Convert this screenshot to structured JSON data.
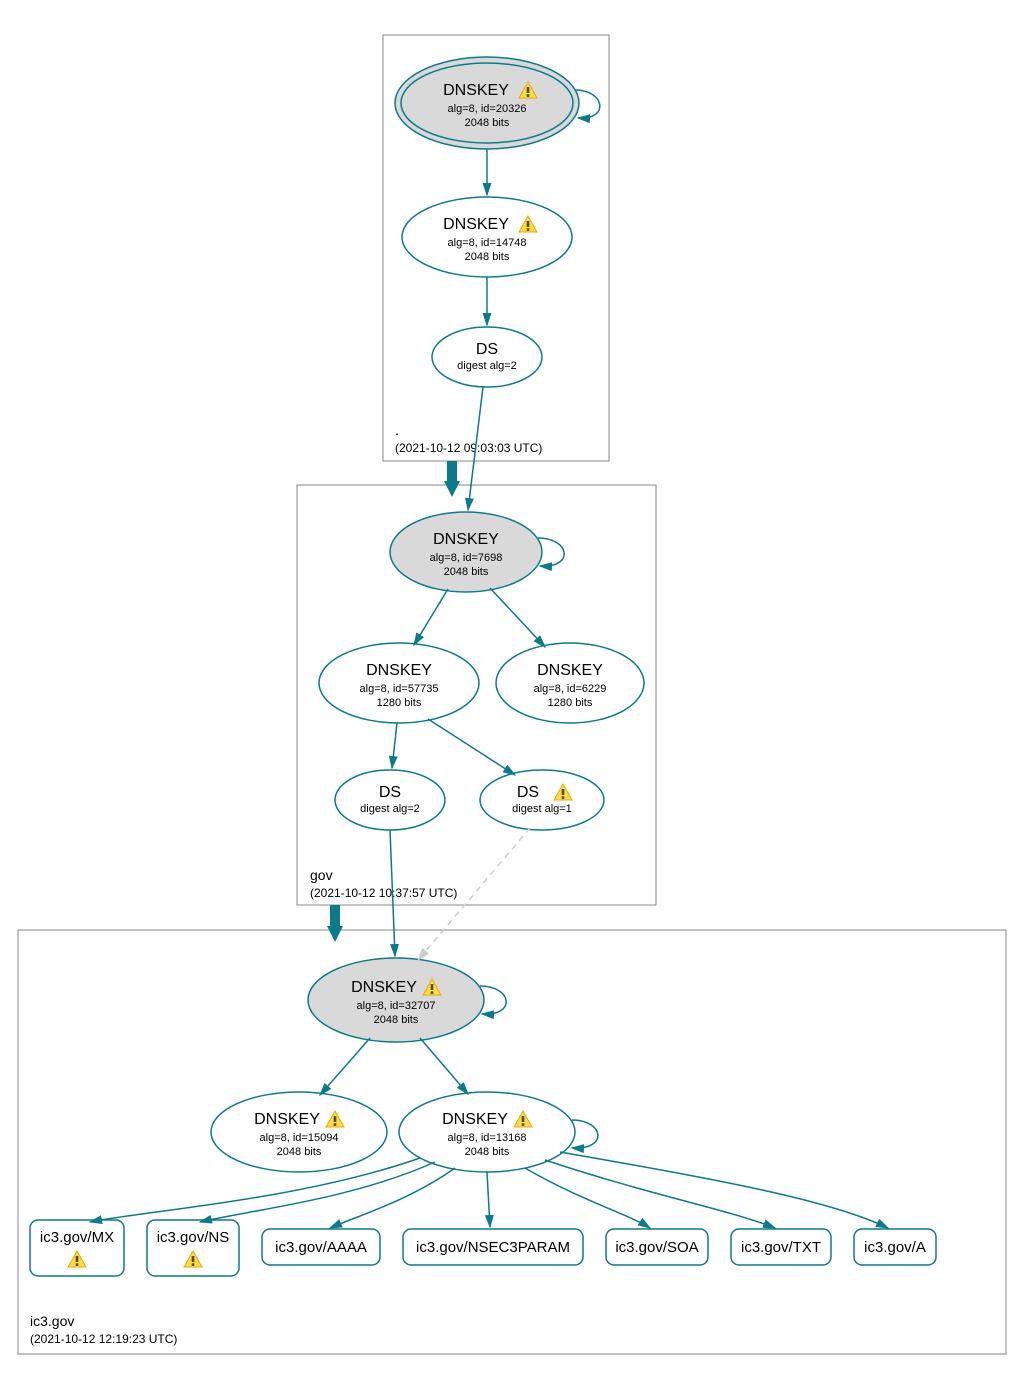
{
  "zones": {
    "root": {
      "label": ".",
      "timestamp": "(2021-10-12 09:03:03 UTC)"
    },
    "gov": {
      "label": "gov",
      "timestamp": "(2021-10-12 10:37:57 UTC)"
    },
    "ic3": {
      "label": "ic3.gov",
      "timestamp": "(2021-10-12 12:19:23 UTC)"
    }
  },
  "nodes": {
    "root_ksk": {
      "title": "DNSKEY",
      "sub1": "alg=8, id=20326",
      "sub2": "2048 bits",
      "warn": true
    },
    "root_zsk": {
      "title": "DNSKEY",
      "sub1": "alg=8, id=14748",
      "sub2": "2048 bits",
      "warn": true
    },
    "root_ds": {
      "title": "DS",
      "sub1": "digest alg=2"
    },
    "gov_ksk": {
      "title": "DNSKEY",
      "sub1": "alg=8, id=7698",
      "sub2": "2048 bits",
      "warn": false
    },
    "gov_zsk_a": {
      "title": "DNSKEY",
      "sub1": "alg=8, id=57735",
      "sub2": "1280 bits",
      "warn": false
    },
    "gov_zsk_b": {
      "title": "DNSKEY",
      "sub1": "alg=8, id=6229",
      "sub2": "1280 bits",
      "warn": false
    },
    "gov_ds_a": {
      "title": "DS",
      "sub1": "digest alg=2"
    },
    "gov_ds_b": {
      "title": "DS",
      "sub1": "digest alg=1",
      "warn": true
    },
    "ic3_ksk": {
      "title": "DNSKEY",
      "sub1": "alg=8, id=32707",
      "sub2": "2048 bits",
      "warn": true
    },
    "ic3_zsk_a": {
      "title": "DNSKEY",
      "sub1": "alg=8, id=15094",
      "sub2": "2048 bits",
      "warn": true
    },
    "ic3_zsk_b": {
      "title": "DNSKEY",
      "sub1": "alg=8, id=13168",
      "sub2": "2048 bits",
      "warn": true
    }
  },
  "records": {
    "mx": {
      "label": "ic3.gov/MX",
      "warn": true
    },
    "ns": {
      "label": "ic3.gov/NS",
      "warn": true
    },
    "aaaa": {
      "label": "ic3.gov/AAAA"
    },
    "nsec3": {
      "label": "ic3.gov/NSEC3PARAM"
    },
    "soa": {
      "label": "ic3.gov/SOA"
    },
    "txt": {
      "label": "ic3.gov/TXT"
    },
    "a": {
      "label": "ic3.gov/A"
    }
  }
}
